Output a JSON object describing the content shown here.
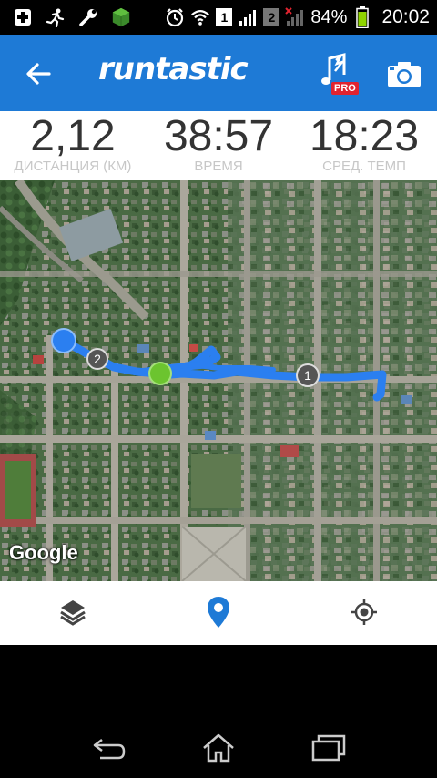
{
  "status_bar": {
    "icons": [
      "plus-box-icon",
      "runner-icon",
      "wrench-icon",
      "cube-icon",
      "alarm-icon",
      "wifi-icon",
      "sim1-icon",
      "signal-icon",
      "sim2-icon",
      "signal-x-icon",
      "battery-icon"
    ],
    "sim1": "1",
    "sim2": "2",
    "battery": "84%",
    "time": "20:02"
  },
  "app_bar": {
    "logo": "runtastic",
    "pro_badge": "PRO",
    "icons": [
      "back-arrow-icon",
      "music-note-icon",
      "camera-icon"
    ]
  },
  "stats": [
    {
      "value": "2,12",
      "label": "ДИСТАНЦИЯ (КМ)"
    },
    {
      "value": "38:57",
      "label": "ВРЕМЯ"
    },
    {
      "value": "18:23",
      "label": "СРЕД. ТЕМП"
    }
  ],
  "map": {
    "attribution": "Google",
    "markers": [
      {
        "label": "1",
        "type": "km-marker"
      },
      {
        "label": "2",
        "type": "km-marker"
      }
    ],
    "route_color": "#2b7ff0",
    "current_color": "#2b7ff0",
    "start_color": "#6cc42f"
  },
  "map_tools": {
    "icons": [
      "layers-icon",
      "location-pin-icon",
      "my-location-icon"
    ],
    "active_color": "#1e7ad6"
  },
  "nav_bar": {
    "icons": [
      "back-icon",
      "home-icon",
      "recents-icon"
    ]
  }
}
